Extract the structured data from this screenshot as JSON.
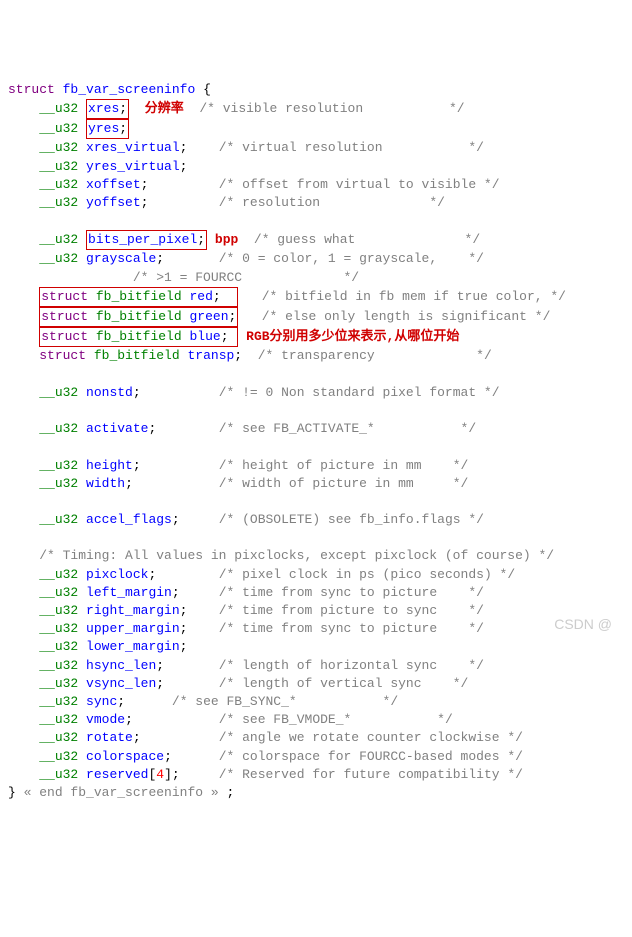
{
  "struct_name": "fb_var_screeninfo",
  "anno_res": "分辨率",
  "anno_bpp": "bpp",
  "anno_rgb": "RGB分别用多少位来表示,从哪位开始",
  "fields": {
    "xres": "xres",
    "yres": "yres",
    "xres_virtual": "xres_virtual",
    "yres_virtual": "yres_virtual",
    "xoffset": "xoffset",
    "yoffset": "yoffset",
    "bits_per_pixel": "bits_per_pixel",
    "grayscale": "grayscale",
    "red": "red",
    "green": "green",
    "blue": "blue",
    "transp": "transp",
    "nonstd": "nonstd",
    "activate": "activate",
    "height": "height",
    "width": "width",
    "accel_flags": "accel_flags",
    "pixclock": "pixclock",
    "left_margin": "left_margin",
    "right_margin": "right_margin",
    "upper_margin": "upper_margin",
    "lower_margin": "lower_margin",
    "hsync_len": "hsync_len",
    "vsync_len": "vsync_len",
    "sync": "sync",
    "vmode": "vmode",
    "rotate": "rotate",
    "colorspace": "colorspace",
    "reserved": "reserved"
  },
  "reserved_size": "4",
  "types": {
    "u32": "__u32",
    "struct": "struct",
    "bitfield": "fb_bitfield"
  },
  "comments": {
    "visible_res": "/* visible resolution           */",
    "virtual_res": "/* virtual resolution           */",
    "offset": "/* offset from virtual to visible */",
    "resolution": "/* resolution              */",
    "guess": "/* guess what              */",
    "grayscale": "/* 0 = color, 1 = grayscale,    */",
    "fourcc": "/* >1 = FOURCC             */",
    "bitfield": "/* bitfield in fb mem if true color, */",
    "else_length": "/* else only length is significant */",
    "transparency": "/* transparency             */",
    "nonstd": "/* != 0 Non standard pixel format */",
    "activate": "/* see FB_ACTIVATE_*           */",
    "height": "/* height of picture in mm    */",
    "width": "/* width of picture in mm     */",
    "accel": "/* (OBSOLETE) see fb_info.flags */",
    "timing": "/* Timing: All values in pixclocks, except pixclock (of course) */",
    "pixclock": "/* pixel clock in ps (pico seconds) */",
    "time_sync": "/* time from sync to picture    */",
    "time_pic": "/* time from picture to sync    */",
    "hsync": "/* length of horizontal sync    */",
    "vsync": "/* length of vertical sync    */",
    "sync": "/* see FB_SYNC_*           */",
    "vmode": "/* see FB_VMODE_*           */",
    "rotate": "/* angle we rotate counter clockwise */",
    "colorspace": "/* colorspace for FOURCC-based modes */",
    "reserved": "/* Reserved for future compatibility */",
    "end": "« end fb_var_screeninfo »"
  },
  "watermark": "CSDN @"
}
